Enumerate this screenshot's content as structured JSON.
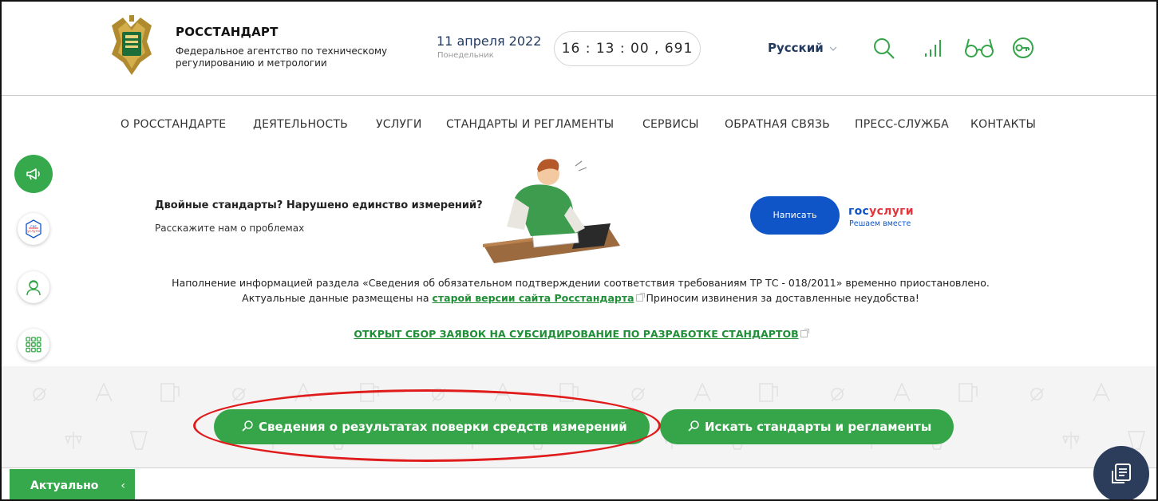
{
  "header": {
    "brand_title": "РОССТАНДАРТ",
    "brand_subtitle": "Федеральное агентство по техническому регулированию и метрологии",
    "date": "11 апреля 2022",
    "weekday": "Понедельник",
    "clock": "16 : 13 : 00 , 691",
    "language": "Русский",
    "icons": [
      "search-icon",
      "signal-icon",
      "glasses-icon",
      "key-icon"
    ]
  },
  "nav": {
    "items": [
      "О РОССТАНДАРТЕ",
      "ДЕЯТЕЛЬНОСТЬ",
      "УСЛУГИ",
      "СТАНДАРТЫ И РЕГЛАМЕНТЫ",
      "СЕРВИСЫ",
      "ОБРАТНАЯ СВЯЗЬ",
      "ПРЕСС-СЛУЖБА",
      "КОНТАКТЫ"
    ]
  },
  "side": {
    "icons": [
      "megaphone-icon",
      "gosuslugi-icon",
      "person-icon",
      "grid-icon"
    ],
    "gos_small": "гос услуги"
  },
  "banner": {
    "title": "Двойные стандарты? Нарушено единство измерений?",
    "subtitle": "Расскажите нам о проблемах",
    "button": "Написать",
    "gos_part1": "гос",
    "gos_part2": "услуги",
    "gos_sub": "Решаем вместе"
  },
  "notice": {
    "line1": "Наполнение информацией раздела «Сведения об обязательном подтверждении соответствия требованиям ТР ТС - 018/2011» временно приостановлено.",
    "line2_prefix": "Актуальные данные размещены на ",
    "line2_link": "старой версии сайта Росстандарта",
    "line2_suffix": " Приносим извинения за доставленные неудобства!",
    "subsidy_link": "ОТКРЫТ СБОР ЗАЯВОК НА СУБСИДИРОВАНИЕ ПО РАЗРАБОТКЕ СТАНДАРТОВ"
  },
  "search": {
    "btn_verification": "Сведения о результатах поверки средств измерений",
    "btn_standards": "Искать стандарты и регламенты"
  },
  "bottom": {
    "actual": "Актуально",
    "chevron": "‹"
  },
  "colors": {
    "green": "#36a54a",
    "blue": "#0f55c7",
    "navy": "#2c3d5c",
    "highlight": "#e01b1b"
  }
}
